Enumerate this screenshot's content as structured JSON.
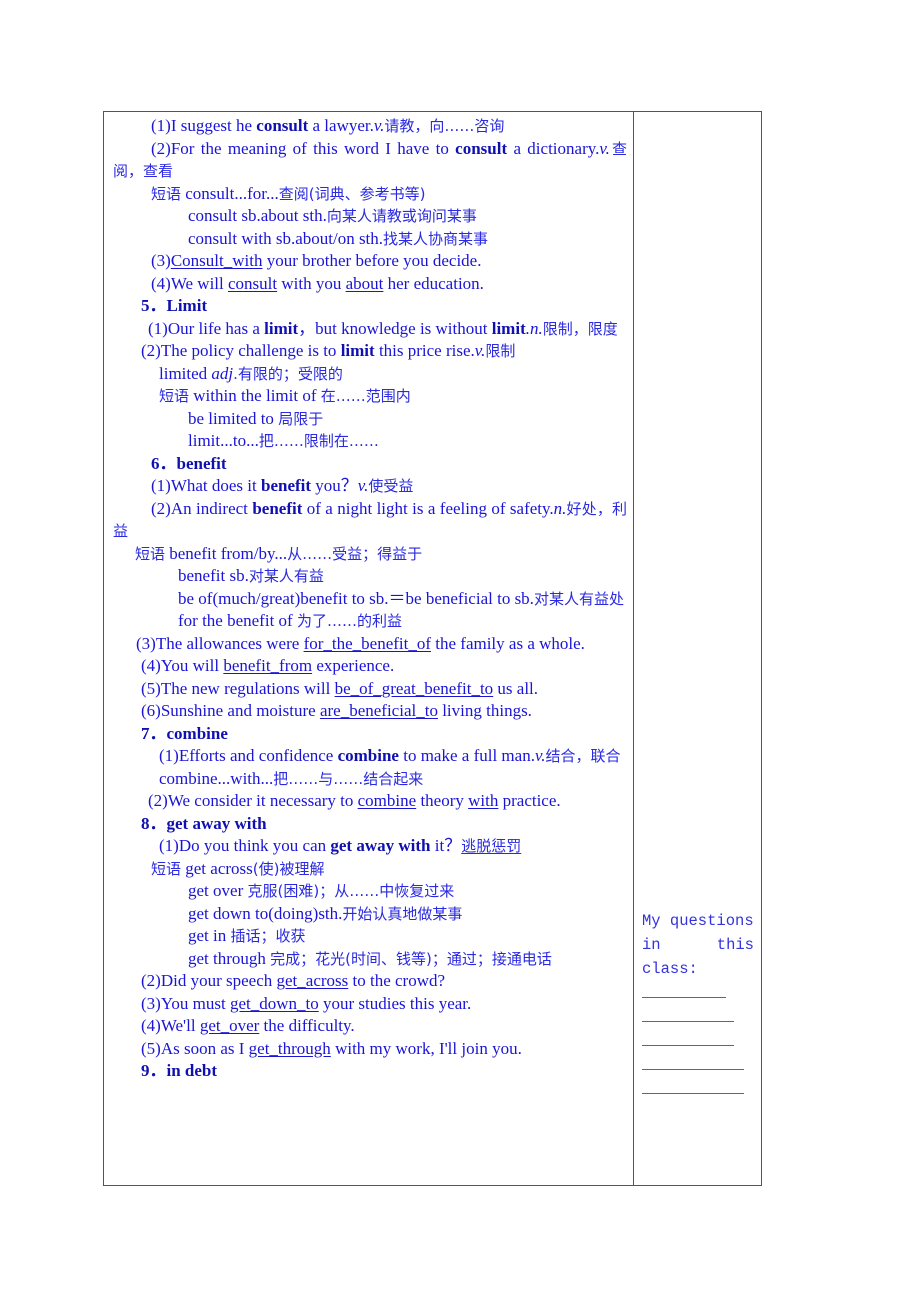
{
  "main": {
    "consult": {
      "ex1": {
        "pre": "(1)I suggest he ",
        "kw": "consult",
        "post": " a lawyer.",
        "pos": "v.",
        "cn": "请教，向……咨询"
      },
      "ex2": {
        "pre": "(2)For the meaning of this word I have to ",
        "kw": "consult",
        "post": " a dictionary.",
        "pos": "v.",
        "cn": "查阅，查看"
      },
      "phrase_label": "短语",
      "phrases": [
        {
          "en": " consult...for...",
          "cn": "查阅(词典、参考书等)"
        },
        {
          "en": "consult sb.about sth.",
          "cn": "向某人请教或询问某事"
        },
        {
          "en": "consult with sb.about/on sth.",
          "cn": "找某人协商某事"
        }
      ],
      "ex3": {
        "pre": "(3)",
        "ans": "Consult_with",
        "post": " your brother before you decide."
      },
      "ex4": {
        "pre": "(4)We will ",
        "ans1": "consult",
        "mid": " with you ",
        "ans2": "about",
        "post": " her education."
      }
    },
    "limit": {
      "heading": "5．Limit",
      "ex1": {
        "pre": "(1)Our life has a ",
        "kw1": "limit",
        "mid": "，but knowledge is without ",
        "kw2": "limit",
        "pos": ".n.",
        "cn": "限制，限度"
      },
      "ex2": {
        "pre": "(2)The policy challenge is to ",
        "kw": "limit",
        "post": " this price rise.",
        "pos": "v.",
        "cn": "限制"
      },
      "adj": {
        "word": "limited ",
        "pos": "adj",
        "cn": ".有限的；受限的"
      },
      "phrase_label": "短语",
      "phrases": [
        {
          "en": " within the limit of ",
          "cn": "在……范围内"
        },
        {
          "en": "be limited to ",
          "cn": "局限于"
        },
        {
          "en": "limit...to...",
          "cn": "把……限制在……"
        }
      ]
    },
    "benefit": {
      "heading": "6．benefit",
      "ex1": {
        "pre": "(1)What does it ",
        "kw": "benefit",
        "post": " you？",
        "pos": "v.",
        "cn": "使受益"
      },
      "ex2": {
        "pre": "(2)An indirect ",
        "kw": "benefit",
        "post": " of a night light is a feeling of safety.",
        "pos": "n.",
        "cn": "好处，利益"
      },
      "phrase_label": "短语",
      "phrases": [
        {
          "en": " benefit from/by...",
          "cn": "从……受益；得益于"
        },
        {
          "en": "benefit sb.",
          "cn": "对某人有益"
        },
        {
          "en": "be of(much/great)benefit to sb.＝be beneficial to sb.",
          "cn": "对某人有益处"
        },
        {
          "en": "for the benefit of ",
          "cn": "为了……的利益"
        }
      ],
      "ex3": {
        "pre": "(3)The allowances were ",
        "ans": "for_the_benefit_of",
        "post": " the family as a whole."
      },
      "ex4": {
        "pre": "(4)You will ",
        "ans": "benefit_from",
        "post": " experience."
      },
      "ex5": {
        "pre": "(5)The new regulations will ",
        "ans": "be_of_great_benefit_to",
        "post": " us all."
      },
      "ex6": {
        "pre": "(6)Sunshine and moisture ",
        "ans": "are_beneficial_to",
        "post": " living things."
      }
    },
    "combine": {
      "heading": "7．combine",
      "ex1": {
        "pre": "(1)Efforts and confidence ",
        "kw": "combine",
        "post": " to make a full man.",
        "pos": "v.",
        "cn": "结合，联合"
      },
      "phrase": {
        "en": "combine...with...",
        "cn": "把……与……结合起来"
      },
      "ex2": {
        "pre": "(2)We consider it necessary to ",
        "ans1": "combine",
        "mid": " theory ",
        "ans2": "with",
        "post": " practice."
      }
    },
    "get_away_with": {
      "heading": "8．get away with",
      "ex1": {
        "pre": "(1)Do you think you can ",
        "kw": "get away with",
        "post": " it？",
        "ans": "逃脱惩罚"
      },
      "phrase_label": "短语",
      "phrases": [
        {
          "en": " get across",
          "cn": "(使)被理解"
        },
        {
          "en": "get over ",
          "cn": "克服(困难)；从……中恢复过来"
        },
        {
          "en": "get down to(doing)sth.",
          "cn": "开始认真地做某事"
        },
        {
          "en": "get in ",
          "cn": "插话；收获"
        },
        {
          "en": "get through ",
          "cn": "完成；花光(时间、钱等)；通过；接通电话"
        }
      ],
      "ex2": {
        "pre": "(2)Did your speech ",
        "ans": "get_across",
        "post": " to the crowd?"
      },
      "ex3": {
        "pre": "(3)You must ",
        "ans": "get_down_to",
        "post": " your studies this year."
      },
      "ex4": {
        "pre": "(4)We'll ",
        "ans": "get_over",
        "post": " the difficulty."
      },
      "ex5": {
        "pre": "(5)As soon as I ",
        "ans": "get_through",
        "post": " with my work, I'll join you."
      }
    },
    "in_debt": {
      "heading": "9．in debt"
    }
  },
  "side": {
    "line1_a": "My questions",
    "line2_a": "in",
    "line2_b": "this",
    "line3": "class:",
    "blank_count": 5
  }
}
